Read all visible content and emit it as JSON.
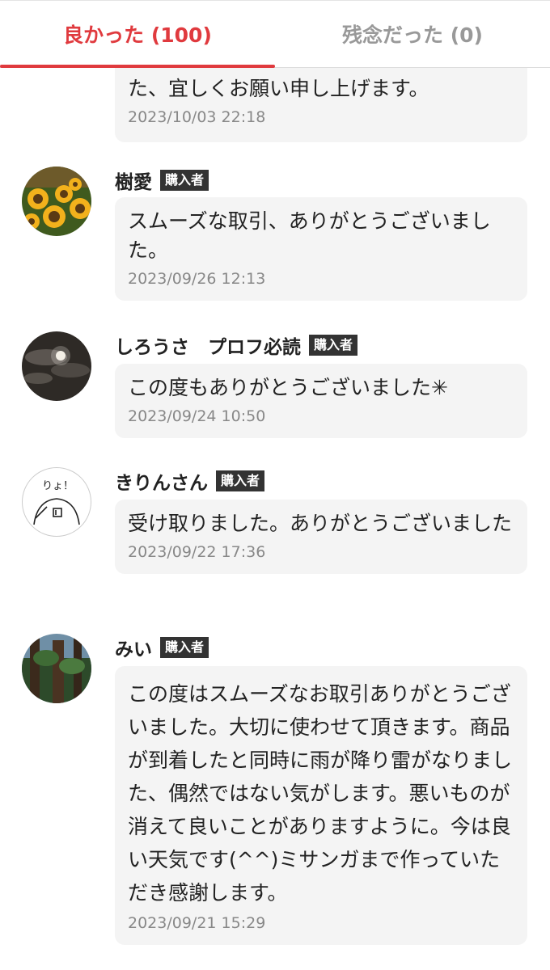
{
  "tabs": {
    "good_label": "良かった (100)",
    "bad_label": "残念だった (0)"
  },
  "colors": {
    "accent": "#e03a3e",
    "bubble": "#f4f4f4",
    "badge": "#333333"
  },
  "badge_label": "購入者",
  "reviews": [
    {
      "comment": "た、宜しくお願い申し上げます。",
      "date": "2023/10/03 22:18"
    },
    {
      "name": "樹愛",
      "badge": "購入者",
      "avatar_icon": "sunflower-photo",
      "comment": "スムーズな取引、ありがとうございました。",
      "date": "2023/09/26 12:13"
    },
    {
      "name": "しろうさ　プロフ必読",
      "badge": "購入者",
      "avatar_icon": "moon-clouds-photo",
      "comment": "この度もありがとうございました✳",
      "date": "2023/09/24 10:50"
    },
    {
      "name": "きりんさん",
      "badge": "購入者",
      "avatar_icon": "cartoon-drawing",
      "avatar_text": "りょ！",
      "comment": "受け取りました。ありがとうございました",
      "date": "2023/09/22 17:36"
    },
    {
      "name": "みい",
      "badge": "購入者",
      "avatar_icon": "forest-photo",
      "comment": "この度はスムーズなお取引ありがとうございました。大切に使わせて頂きます。商品が到着したと同時に雨が降り雷がなりました、偶然ではない気がします。悪いものが消えて良いことがありますように。今は良い天気です(^^)ミサンガまで作っていただき感謝します。",
      "date": "2023/09/21 15:29"
    }
  ]
}
